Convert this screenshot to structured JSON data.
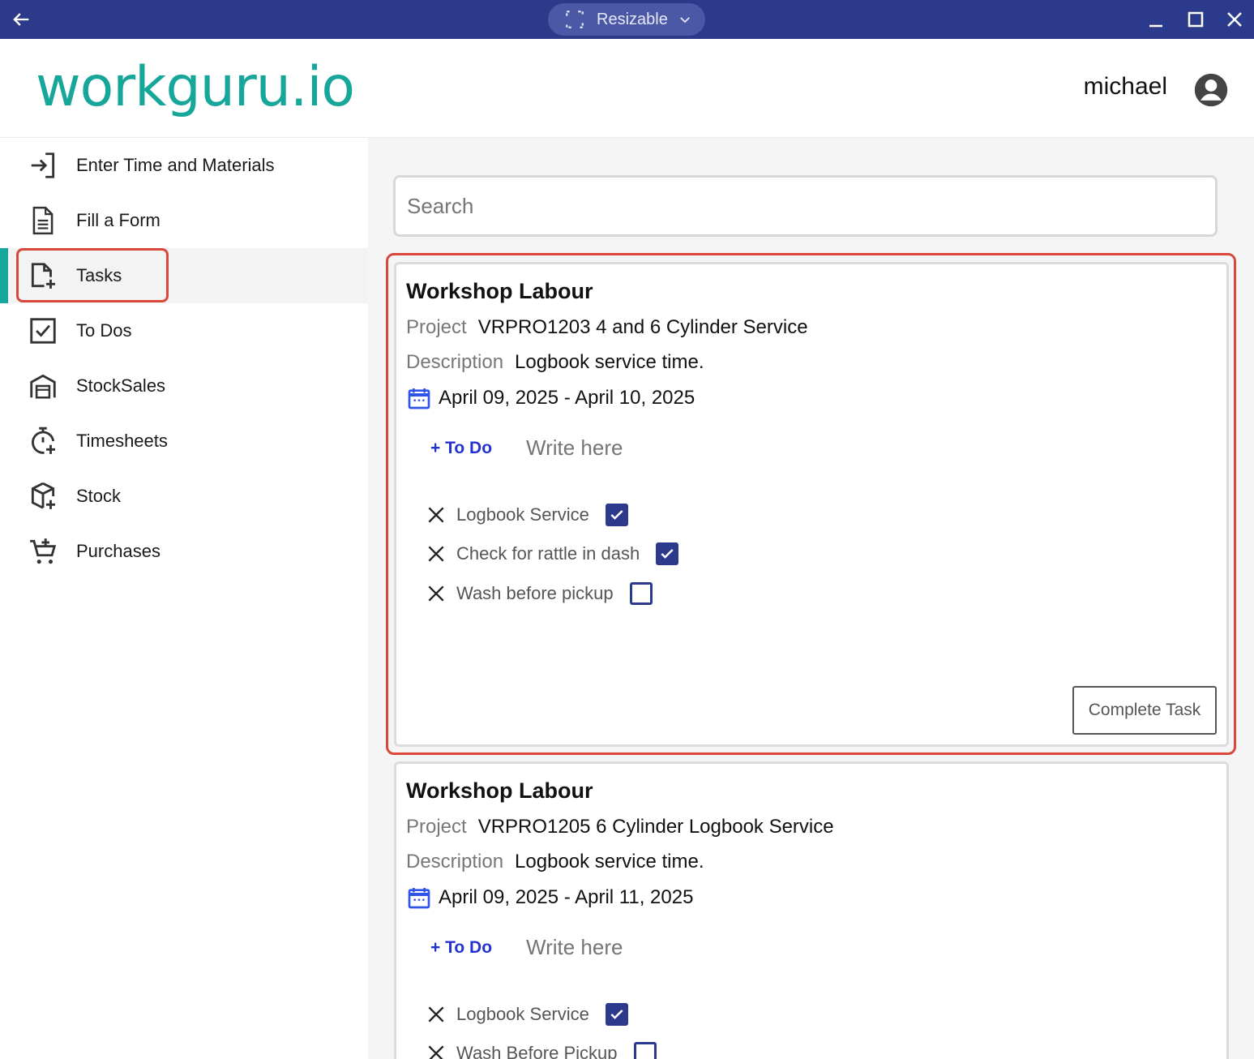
{
  "titlebar": {
    "window_mode": "Resizable"
  },
  "header": {
    "logo": "workguru.io",
    "username": "michael"
  },
  "sidebar": {
    "items": [
      {
        "label": "Enter Time and Materials",
        "icon": "enter-icon"
      },
      {
        "label": "Fill a Form",
        "icon": "form-icon"
      },
      {
        "label": "Tasks",
        "icon": "tasks-icon",
        "active": true
      },
      {
        "label": "To Dos",
        "icon": "checkbox-icon"
      },
      {
        "label": "StockSales",
        "icon": "store-icon"
      },
      {
        "label": "Timesheets",
        "icon": "timer-icon"
      },
      {
        "label": "Stock",
        "icon": "package-icon"
      },
      {
        "label": "Purchases",
        "icon": "cart-icon"
      }
    ]
  },
  "search": {
    "placeholder": "Search"
  },
  "tasks": [
    {
      "title": "Workshop Labour",
      "project_key": "Project",
      "project_value": "VRPRO1203  4 and 6 Cylinder Service",
      "description_key": "Description",
      "description_value": "Logbook service time.",
      "dates": "April 09, 2025  -  April 10, 2025",
      "todo_add_label": "+ To Do",
      "todo_placeholder": "Write here",
      "todos": [
        {
          "label": "Logbook Service",
          "checked": true
        },
        {
          "label": "Check for rattle in dash",
          "checked": true
        },
        {
          "label": "Wash before pickup",
          "checked": false
        }
      ],
      "complete_label": "Complete Task"
    },
    {
      "title": "Workshop Labour",
      "project_key": "Project",
      "project_value": "VRPRO1205  6 Cylinder Logbook Service",
      "description_key": "Description",
      "description_value": "Logbook service time.",
      "dates": "April 09, 2025  -  April 11, 2025",
      "todo_add_label": "+ To Do",
      "todo_placeholder": "Write here",
      "todos": [
        {
          "label": "Logbook Service",
          "checked": true
        },
        {
          "label": "Wash Before Pickup",
          "checked": false
        }
      ]
    }
  ],
  "colors": {
    "titlebar": "#2c3a8c",
    "brand_teal": "#17a69a",
    "highlight_red": "#d9483b",
    "link_blue": "#2433d0"
  }
}
